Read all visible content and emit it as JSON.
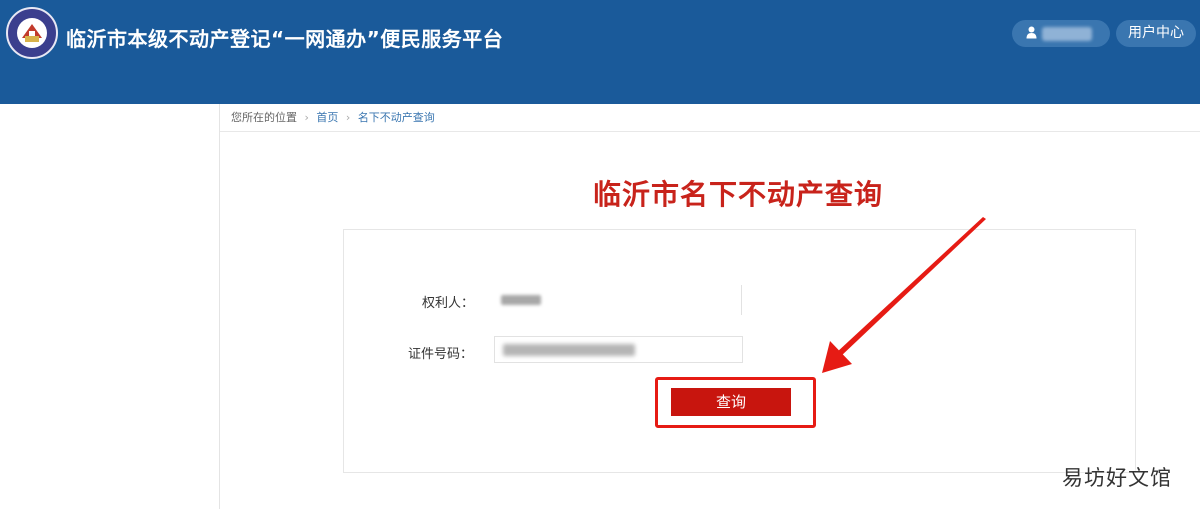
{
  "header": {
    "title": "临沂市本级不动产登记“一网通办”便民服务平台",
    "user_center_label": "用户中心",
    "user_icon": "user-icon",
    "logo_icon": "emblem-icon",
    "background_color": "#1a5a9a"
  },
  "breadcrumb": {
    "prefix": "您所在的位置",
    "home": "首页",
    "current": "名下不动产查询"
  },
  "page": {
    "title": "临沂市名下不动产查询",
    "title_color": "#c8231b"
  },
  "form": {
    "owner_label": "权利人：",
    "id_label": "证件号码：",
    "query_button": "查询",
    "button_color": "#c8150e"
  },
  "annotation": {
    "highlight_color": "#e61b14",
    "arrow_icon": "arrow-icon"
  },
  "watermark": {
    "text": "易坊好文馆"
  }
}
